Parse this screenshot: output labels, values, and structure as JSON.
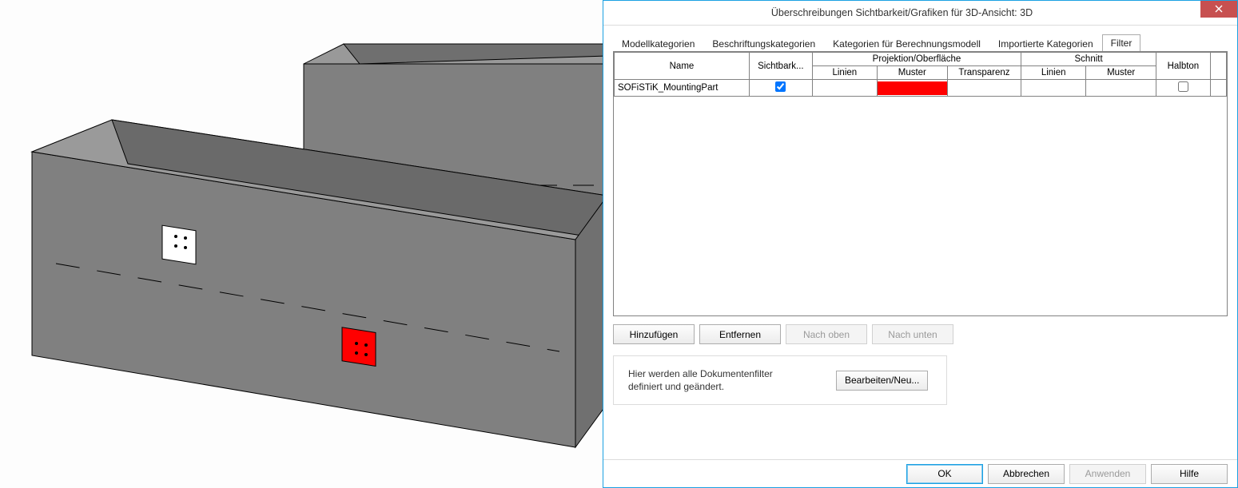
{
  "dialog": {
    "title": "Überschreibungen Sichtbarkeit/Grafiken für 3D-Ansicht: 3D",
    "close_icon": "✕"
  },
  "tabs": {
    "model": "Modellkategorien",
    "annotation": "Beschriftungskategorien",
    "analytical": "Kategorien für Berechnungsmodell",
    "imported": "Importierte Kategorien",
    "filter": "Filter"
  },
  "table": {
    "headers": {
      "name": "Name",
      "visibility": "Sichtbark...",
      "projection_group": "Projektion/Oberfläche",
      "proj_lines": "Linien",
      "proj_pattern": "Muster",
      "proj_transparency": "Transparenz",
      "cut_group": "Schnitt",
      "cut_lines": "Linien",
      "cut_pattern": "Muster",
      "halftone": "Halbton"
    },
    "rows": [
      {
        "name": "SOFiSTiK_MountingPart",
        "visible": true,
        "proj_lines": "",
        "proj_pattern_color": "#ff0000",
        "proj_transparency": "",
        "cut_lines": "",
        "cut_pattern": "",
        "halftone": false
      }
    ]
  },
  "buttons": {
    "add": "Hinzufügen",
    "remove": "Entfernen",
    "up": "Nach oben",
    "down": "Nach unten",
    "edit_new": "Bearbeiten/Neu..."
  },
  "note": "Hier werden alle Dokumentenfilter definiert und geändert.",
  "footer": {
    "ok": "OK",
    "cancel": "Abbrechen",
    "apply": "Anwenden",
    "help": "Hilfe"
  },
  "viewport": {
    "description": "3D isometric view of two precast concrete beams with mounting parts",
    "mounting_part_highlight_color": "#ff0000"
  }
}
